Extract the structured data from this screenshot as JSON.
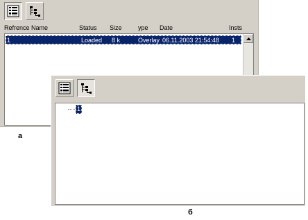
{
  "panel_a": {
    "toolbar": [
      {
        "name": "list-view-icon",
        "pressed": true
      },
      {
        "name": "tree-view-icon",
        "pressed": false
      }
    ],
    "columns": [
      "Reference Name",
      "Status",
      "Size",
      "Type",
      "Date",
      "Instance"
    ],
    "columns_visible": [
      "Refrence Name",
      "Status",
      "Size",
      "ype",
      "Date",
      "Insts"
    ],
    "rows": [
      {
        "reference_name": "1",
        "status": "Loaded",
        "size": "8 k",
        "type": "Overlay",
        "date": "06.11.2003 21:54:48",
        "instance": "1"
      }
    ]
  },
  "panel_b": {
    "toolbar": [
      {
        "name": "list-view-icon",
        "pressed": false
      },
      {
        "name": "tree-view-icon",
        "pressed": true
      }
    ],
    "tree_root": "1"
  },
  "captions": {
    "a": "a",
    "b": "б"
  }
}
